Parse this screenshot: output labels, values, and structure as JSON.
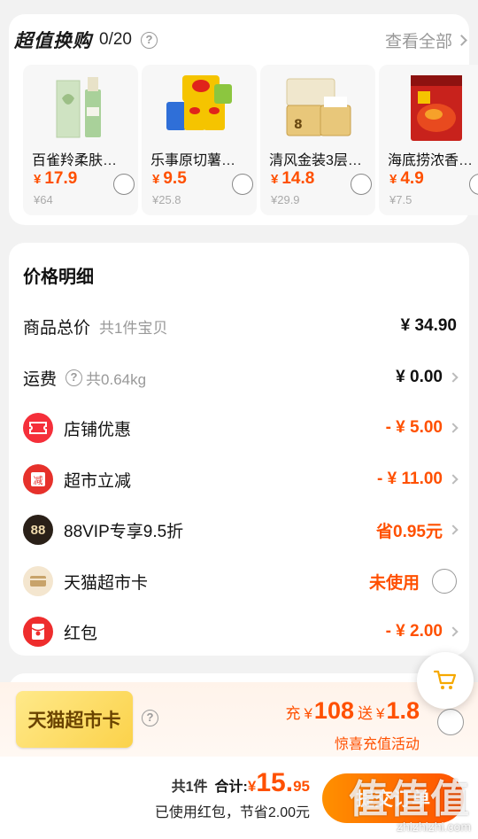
{
  "deals": {
    "title": "超值换购",
    "count": "0/20",
    "view_all": "查看全部",
    "products": [
      {
        "name": "百雀羚柔肤…",
        "price": "17.9",
        "old": "¥64"
      },
      {
        "name": "乐事原切薯…",
        "price": "9.5",
        "old": "¥25.8"
      },
      {
        "name": "清风金装3层…",
        "price": "14.8",
        "old": "¥29.9"
      },
      {
        "name": "海底捞浓香…",
        "price": "4.9",
        "old": "¥7.5"
      }
    ]
  },
  "price_detail": {
    "title": "价格明细",
    "total_label": "商品总价",
    "total_sub": "共1件宝贝",
    "total_value": "¥ 34.90",
    "shipping_label": "运费",
    "shipping_sub": "共0.64kg",
    "shipping_value": "¥ 0.00",
    "shop_discount_label": "店铺优惠",
    "shop_discount_value": "- ¥ 5.00",
    "market_discount_label": "超市立减",
    "market_discount_icon_text": "减",
    "market_discount_value": "- ¥ 11.00",
    "vip_label": "88VIP专享9.5折",
    "vip_icon_text": "88",
    "vip_value": "省0.95元",
    "card_label": "天猫超市卡",
    "card_value": "未使用",
    "redpacket_label": "红包",
    "redpacket_value": "- ¥ 2.00"
  },
  "recharge": {
    "card_text": "天猫超市卡",
    "prefix": "充",
    "currency": "¥",
    "amount": "108",
    "gift": "送",
    "gift_amount": "1.8",
    "activity": "惊喜充值活动"
  },
  "footer": {
    "count": "共1件",
    "total_label": "合计:",
    "currency": "¥",
    "total_int": "15.",
    "total_dec": "95",
    "saved": "已使用红包，节省2.00元",
    "submit": "提交订单"
  },
  "watermark": {
    "big": "值值值",
    "small": "zhizhizhi.com"
  },
  "colors": {
    "accent": "#ff5000",
    "submit_gradient_start": "#ff9000",
    "card_gold": "#fbd24a"
  }
}
